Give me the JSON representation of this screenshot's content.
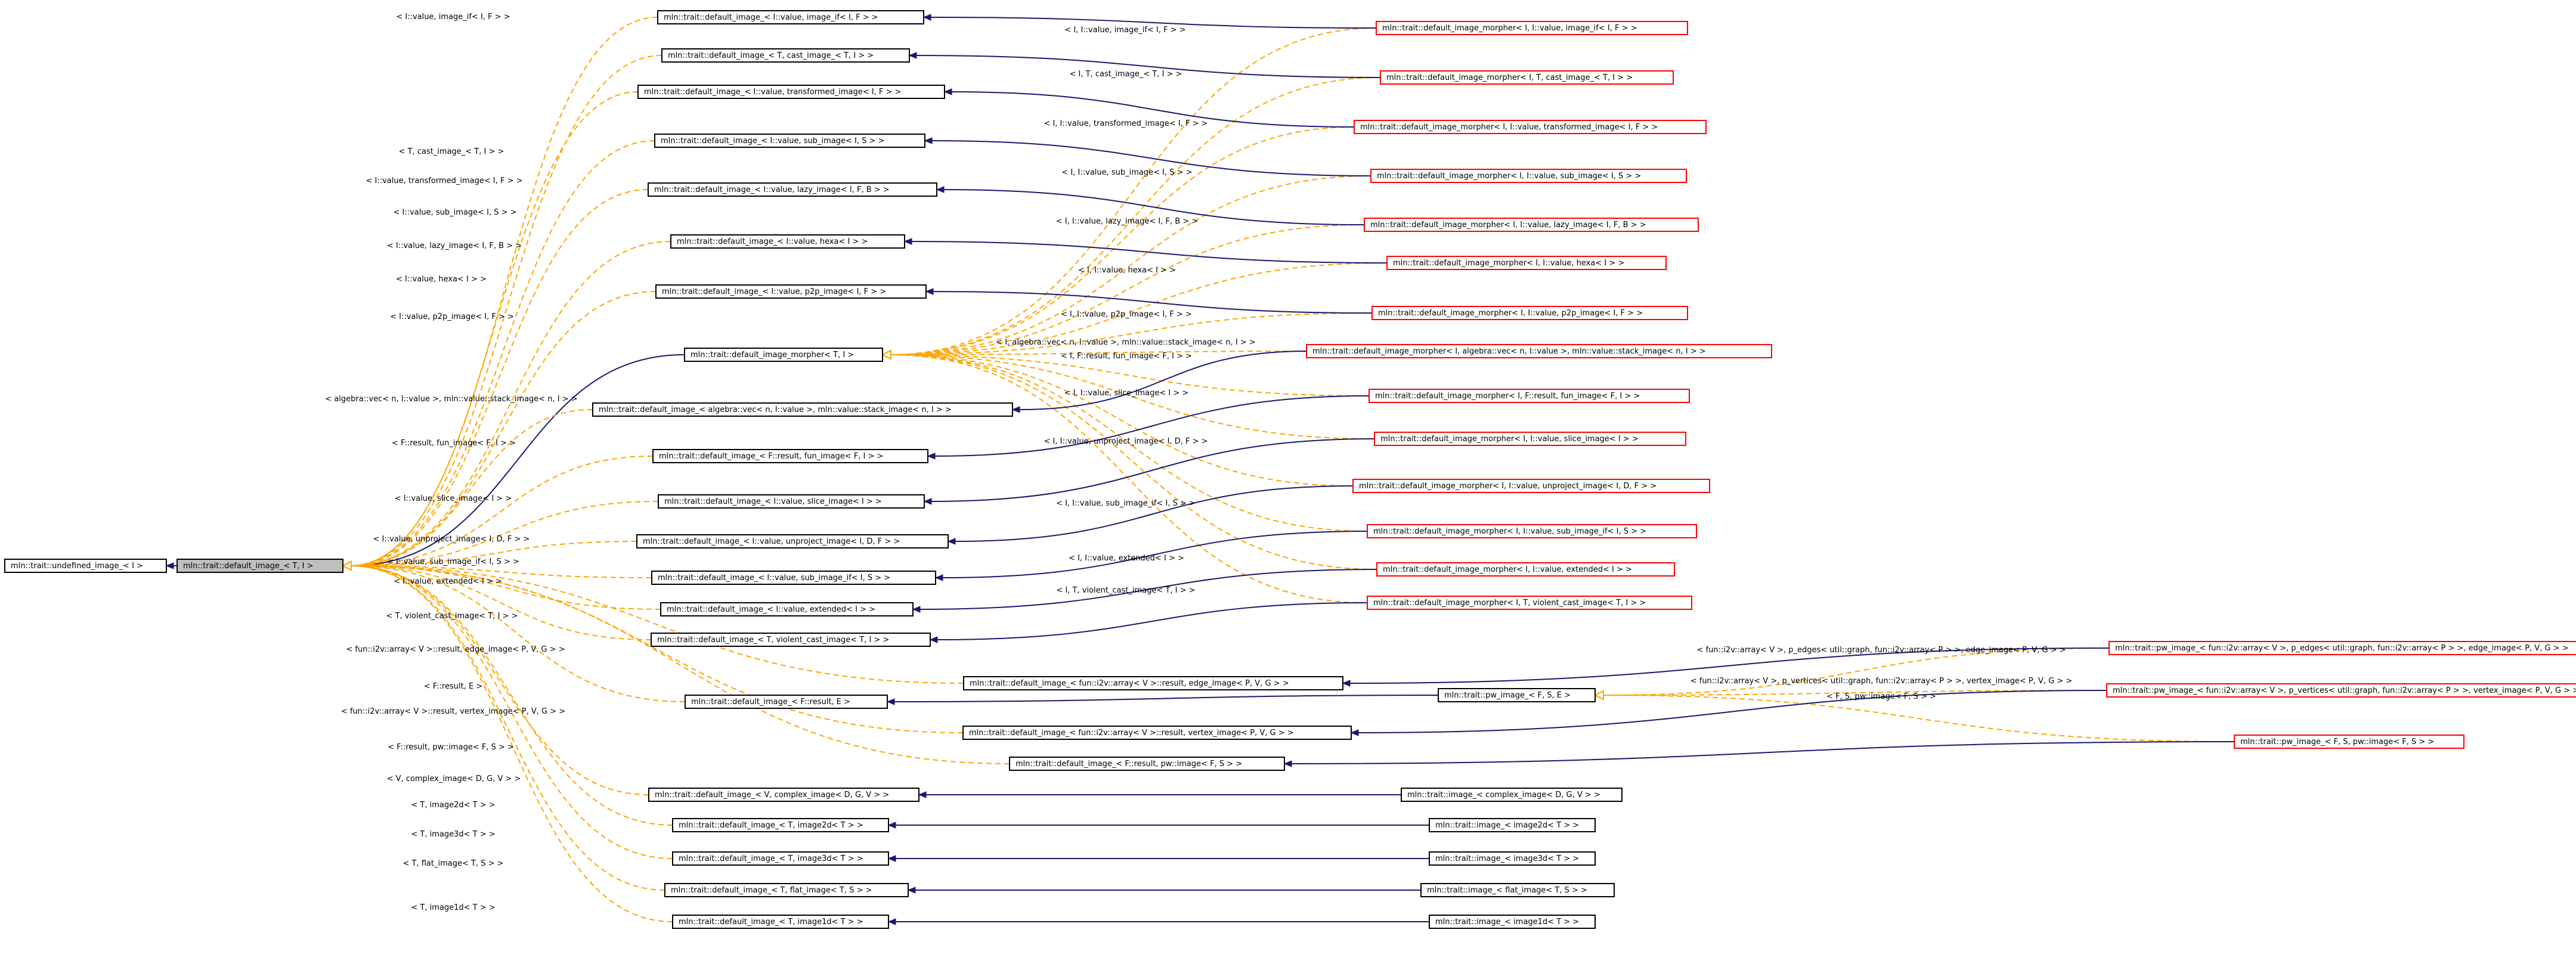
{
  "nodes": [
    {
      "id": "undef",
      "label": "mln::trait::undefined_image_< I >",
      "style": "normal"
    },
    {
      "id": "default",
      "label": "mln::trait::default_image_< T, I >",
      "style": "focus"
    },
    {
      "id": "morpher",
      "label": "mln::trait::default_image_morpher< T, I >",
      "style": "normal"
    },
    {
      "id": "di_image_if",
      "label": "mln::trait::default_image_< I::value, image_if< I, F > >",
      "style": "normal"
    },
    {
      "id": "di_cast",
      "label": "mln::trait::default_image_< T, cast_image_< T, I > >",
      "style": "normal"
    },
    {
      "id": "di_transformed",
      "label": "mln::trait::default_image_< I::value, transformed_image< I, F > >",
      "style": "normal"
    },
    {
      "id": "di_sub",
      "label": "mln::trait::default_image_< I::value, sub_image< I, S > >",
      "style": "normal"
    },
    {
      "id": "di_lazy",
      "label": "mln::trait::default_image_< I::value, lazy_image< I, F, B > >",
      "style": "normal"
    },
    {
      "id": "di_hexa",
      "label": "mln::trait::default_image_< I::value, hexa< I > >",
      "style": "normal"
    },
    {
      "id": "di_p2p",
      "label": "mln::trait::default_image_< I::value, p2p_image< I, F > >",
      "style": "normal"
    },
    {
      "id": "di_stack",
      "label": "mln::trait::default_image_< algebra::vec< n, I::value >, mln::value::stack_image< n, I > >",
      "style": "normal"
    },
    {
      "id": "di_fun",
      "label": "mln::trait::default_image_< F::result, fun_image< F, I > >",
      "style": "normal"
    },
    {
      "id": "di_slice",
      "label": "mln::trait::default_image_< I::value, slice_image< I > >",
      "style": "normal"
    },
    {
      "id": "di_unproject",
      "label": "mln::trait::default_image_< I::value, unproject_image< I, D, F > >",
      "style": "normal"
    },
    {
      "id": "di_subif",
      "label": "mln::trait::default_image_< I::value, sub_image_if< I, S > >",
      "style": "normal"
    },
    {
      "id": "di_extended",
      "label": "mln::trait::default_image_< I::value, extended< I > >",
      "style": "normal"
    },
    {
      "id": "di_violent",
      "label": "mln::trait::default_image_< T, violent_cast_image< T, I > >",
      "style": "normal"
    },
    {
      "id": "di_edge",
      "label": "mln::trait::default_image_< fun::i2v::array< V >::result, edge_image< P, V, G > >",
      "style": "normal"
    },
    {
      "id": "di_fresult_e",
      "label": "mln::trait::default_image_< F::result, E >",
      "style": "normal"
    },
    {
      "id": "di_vertex",
      "label": "mln::trait::default_image_< fun::i2v::array< V >::result, vertex_image< P, V, G > >",
      "style": "normal"
    },
    {
      "id": "di_pw",
      "label": "mln::trait::default_image_< F::result, pw::image< F, S > >",
      "style": "normal"
    },
    {
      "id": "di_complex",
      "label": "mln::trait::default_image_< V, complex_image< D, G, V > >",
      "style": "normal"
    },
    {
      "id": "di_image2d",
      "label": "mln::trait::default_image_< T, image2d< T > >",
      "style": "normal"
    },
    {
      "id": "di_image3d",
      "label": "mln::trait::default_image_< T, image3d< T > >",
      "style": "normal"
    },
    {
      "id": "di_flat",
      "label": "mln::trait::default_image_< T, flat_image< T, S > >",
      "style": "normal"
    },
    {
      "id": "di_image1d",
      "label": "mln::trait::default_image_< T, image1d< T > >",
      "style": "normal"
    },
    {
      "id": "pw_fse",
      "label": "mln::trait::pw_image_< F, S, E >",
      "style": "normal"
    },
    {
      "id": "img_complex",
      "label": "mln::trait::image_< complex_image< D, G, V > >",
      "style": "normal"
    },
    {
      "id": "img_2d",
      "label": "mln::trait::image_< image2d< T > >",
      "style": "normal"
    },
    {
      "id": "img_3d",
      "label": "mln::trait::image_< image3d< T > >",
      "style": "normal"
    },
    {
      "id": "img_flat",
      "label": "mln::trait::image_< flat_image< T, S > >",
      "style": "normal"
    },
    {
      "id": "img_1d",
      "label": "mln::trait::image_< image1d< T > >",
      "style": "normal"
    },
    {
      "id": "dm_image_if",
      "label": "mln::trait::default_image_morpher< I, I::value, image_if< I, F > >",
      "style": "red"
    },
    {
      "id": "dm_cast",
      "label": "mln::trait::default_image_morpher< I, T, cast_image_< T, I > >",
      "style": "red"
    },
    {
      "id": "dm_transformed",
      "label": "mln::trait::default_image_morpher< I, I::value, transformed_image< I, F > >",
      "style": "red"
    },
    {
      "id": "dm_sub",
      "label": "mln::trait::default_image_morpher< I, I::value, sub_image< I, S > >",
      "style": "red"
    },
    {
      "id": "dm_lazy",
      "label": "mln::trait::default_image_morpher< I, I::value, lazy_image< I, F, B > >",
      "style": "red"
    },
    {
      "id": "dm_hexa",
      "label": "mln::trait::default_image_morpher< I, I::value, hexa< I > >",
      "style": "red"
    },
    {
      "id": "dm_p2p",
      "label": "mln::trait::default_image_morpher< I, I::value, p2p_image< I, F > >",
      "style": "red"
    },
    {
      "id": "dm_stack",
      "label": "mln::trait::default_image_morpher< I, algebra::vec< n, I::value >, mln::value::stack_image< n, I > >",
      "style": "red"
    },
    {
      "id": "dm_fun",
      "label": "mln::trait::default_image_morpher< I, F::result, fun_image< F, I > >",
      "style": "red"
    },
    {
      "id": "dm_slice",
      "label": "mln::trait::default_image_morpher< I, I::value, slice_image< I > >",
      "style": "red"
    },
    {
      "id": "dm_unproject",
      "label": "mln::trait::default_image_morpher< I, I::value, unproject_image< I, D, F > >",
      "style": "red"
    },
    {
      "id": "dm_subif",
      "label": "mln::trait::default_image_morpher< I, I::value, sub_image_if< I, S > >",
      "style": "red"
    },
    {
      "id": "dm_extended",
      "label": "mln::trait::default_image_morpher< I, I::value, extended< I > >",
      "style": "red"
    },
    {
      "id": "dm_violent",
      "label": "mln::trait::default_image_morpher< I, T, violent_cast_image< T, I > >",
      "style": "red"
    },
    {
      "id": "pw_edge",
      "label": "mln::trait::pw_image_< fun::i2v::array< V >, p_edges< util::graph, fun::i2v::array< P > >, edge_image< P, V, G > >",
      "style": "red"
    },
    {
      "id": "pw_vertex",
      "label": "mln::trait::pw_image_< fun::i2v::array< V >, p_vertices< util::graph, fun::i2v::array< P > >, vertex_image< P, V, G > >",
      "style": "red"
    },
    {
      "id": "pw_image",
      "label": "mln::trait::pw_image_< F, S, pw::image< F, S > >",
      "style": "red"
    }
  ],
  "edges": [
    {
      "from": "default",
      "to": "undef",
      "style": "solid"
    },
    {
      "from": "morpher",
      "to": "default",
      "style": "solid"
    },
    {
      "from": "di_image_if",
      "to": "default",
      "style": "dashed",
      "label": "< I::value, image_if< I, F > >"
    },
    {
      "from": "di_cast",
      "to": "default",
      "style": "dashed",
      "label": "< T, cast_image_< T, I > >"
    },
    {
      "from": "di_transformed",
      "to": "default",
      "style": "dashed",
      "label": "< I::value, transformed_image< I, F > >"
    },
    {
      "from": "di_sub",
      "to": "default",
      "style": "dashed",
      "label": "< I::value, sub_image< I, S > >"
    },
    {
      "from": "di_lazy",
      "to": "default",
      "style": "dashed",
      "label": "< I::value, lazy_image< I, F, B > >"
    },
    {
      "from": "di_hexa",
      "to": "default",
      "style": "dashed",
      "label": "< I::value, hexa< I > >"
    },
    {
      "from": "di_p2p",
      "to": "default",
      "style": "dashed",
      "label": "< I::value, p2p_image< I, F > >"
    },
    {
      "from": "di_stack",
      "to": "default",
      "style": "dashed",
      "label": "< algebra::vec< n, I::value >, mln::value::stack_image< n, I > >"
    },
    {
      "from": "di_fun",
      "to": "default",
      "style": "dashed",
      "label": "< F::result, fun_image< F, I > >"
    },
    {
      "from": "di_slice",
      "to": "default",
      "style": "dashed",
      "label": "< I::value, slice_image< I > >"
    },
    {
      "from": "di_unproject",
      "to": "default",
      "style": "dashed",
      "label": "< I::value, unproject_image< I, D, F > >"
    },
    {
      "from": "di_subif",
      "to": "default",
      "style": "dashed",
      "label": "< I::value, sub_image_if< I, S > >"
    },
    {
      "from": "di_extended",
      "to": "default",
      "style": "dashed",
      "label": "< I::value, extended< I > >"
    },
    {
      "from": "di_violent",
      "to": "default",
      "style": "dashed",
      "label": "< T, violent_cast_image< T, I > >"
    },
    {
      "from": "di_edge",
      "to": "default",
      "style": "dashed",
      "label": "< fun::i2v::array< V >::result, edge_image< P, V, G > >"
    },
    {
      "from": "di_fresult_e",
      "to": "default",
      "style": "dashed",
      "label": "< F::result, E >"
    },
    {
      "from": "di_vertex",
      "to": "default",
      "style": "dashed",
      "label": "< fun::i2v::array< V >::result, vertex_image< P, V, G > >"
    },
    {
      "from": "di_pw",
      "to": "default",
      "style": "dashed",
      "label": "< F::result, pw::image< F, S > >"
    },
    {
      "from": "di_complex",
      "to": "default",
      "style": "dashed",
      "label": "< V, complex_image< D, G, V > >"
    },
    {
      "from": "di_image2d",
      "to": "default",
      "style": "dashed",
      "label": "< T, image2d< T > >"
    },
    {
      "from": "di_image3d",
      "to": "default",
      "style": "dashed",
      "label": "< T, image3d< T > >"
    },
    {
      "from": "di_flat",
      "to": "default",
      "style": "dashed",
      "label": "< T, flat_image< T, S > >"
    },
    {
      "from": "di_image1d",
      "to": "default",
      "style": "dashed",
      "label": "< T, image1d< T > >"
    },
    {
      "from": "dm_image_if",
      "to": "morpher",
      "style": "dashed",
      "label": "< I, I::value, image_if< I, F > >"
    },
    {
      "from": "dm_cast",
      "to": "morpher",
      "style": "dashed",
      "label": "< I, T, cast_image_< T, I > >"
    },
    {
      "from": "dm_transformed",
      "to": "morpher",
      "style": "dashed",
      "label": "< I, I::value, transformed_image< I, F > >"
    },
    {
      "from": "dm_sub",
      "to": "morpher",
      "style": "dashed",
      "label": "< I, I::value, sub_image< I, S > >"
    },
    {
      "from": "dm_lazy",
      "to": "morpher",
      "style": "dashed",
      "label": "< I, I::value, lazy_image< I, F, B > >"
    },
    {
      "from": "dm_hexa",
      "to": "morpher",
      "style": "dashed",
      "label": "< I, I::value, hexa< I > >"
    },
    {
      "from": "dm_p2p",
      "to": "morpher",
      "style": "dashed",
      "label": "< I, I::value, p2p_image< I, F > >"
    },
    {
      "from": "dm_stack",
      "to": "morpher",
      "style": "dashed",
      "label": "< I, algebra::vec< n, I::value >, mln::value::stack_image< n, I > >"
    },
    {
      "from": "dm_fun",
      "to": "morpher",
      "style": "dashed",
      "label": "< I, F::result, fun_image< F, I > >"
    },
    {
      "from": "dm_slice",
      "to": "morpher",
      "style": "dashed",
      "label": "< I, I::value, slice_image< I > >"
    },
    {
      "from": "dm_unproject",
      "to": "morpher",
      "style": "dashed",
      "label": "< I, I::value, unproject_image< I, D, F > >"
    },
    {
      "from": "dm_subif",
      "to": "morpher",
      "style": "dashed",
      "label": "< I, I::value, sub_image_if< I, S > >"
    },
    {
      "from": "dm_extended",
      "to": "morpher",
      "style": "dashed",
      "label": "< I, I::value, extended< I > >"
    },
    {
      "from": "dm_violent",
      "to": "morpher",
      "style": "dashed",
      "label": "< I, T, violent_cast_image< T, I > >"
    },
    {
      "from": "dm_image_if",
      "to": "di_image_if",
      "style": "solid"
    },
    {
      "from": "dm_cast",
      "to": "di_cast",
      "style": "solid"
    },
    {
      "from": "dm_transformed",
      "to": "di_transformed",
      "style": "solid"
    },
    {
      "from": "dm_sub",
      "to": "di_sub",
      "style": "solid"
    },
    {
      "from": "dm_lazy",
      "to": "di_lazy",
      "style": "solid"
    },
    {
      "from": "dm_hexa",
      "to": "di_hexa",
      "style": "solid"
    },
    {
      "from": "dm_p2p",
      "to": "di_p2p",
      "style": "solid"
    },
    {
      "from": "dm_stack",
      "to": "di_stack",
      "style": "solid"
    },
    {
      "from": "dm_fun",
      "to": "di_fun",
      "style": "solid"
    },
    {
      "from": "dm_slice",
      "to": "di_slice",
      "style": "solid"
    },
    {
      "from": "dm_unproject",
      "to": "di_unproject",
      "style": "solid"
    },
    {
      "from": "dm_subif",
      "to": "di_subif",
      "style": "solid"
    },
    {
      "from": "dm_extended",
      "to": "di_extended",
      "style": "solid"
    },
    {
      "from": "dm_violent",
      "to": "di_violent",
      "style": "solid"
    },
    {
      "from": "pw_fse",
      "to": "di_fresult_e",
      "style": "solid"
    },
    {
      "from": "pw_edge",
      "to": "pw_fse",
      "style": "dashed",
      "label": "< fun::i2v::array< V >, p_edges< util::graph, fun::i2v::array< P > >, edge_image< P, V, G > >"
    },
    {
      "from": "pw_vertex",
      "to": "pw_fse",
      "style": "dashed",
      "label": "< fun::i2v::array< V >, p_vertices< util::graph, fun::i2v::array< P > >, vertex_image< P, V, G > >"
    },
    {
      "from": "pw_image",
      "to": "pw_fse",
      "style": "dashed",
      "label": "< F, S, pw::image< F, S > >"
    },
    {
      "from": "pw_edge",
      "to": "di_edge",
      "style": "solid"
    },
    {
      "from": "pw_vertex",
      "to": "di_vertex",
      "style": "solid"
    },
    {
      "from": "pw_image",
      "to": "di_pw",
      "style": "solid"
    },
    {
      "from": "img_complex",
      "to": "di_complex",
      "style": "solid"
    },
    {
      "from": "img_2d",
      "to": "di_image2d",
      "style": "solid"
    },
    {
      "from": "img_3d",
      "to": "di_image3d",
      "style": "solid"
    },
    {
      "from": "img_flat",
      "to": "di_flat",
      "style": "solid"
    },
    {
      "from": "img_1d",
      "to": "di_image1d",
      "style": "solid"
    }
  ],
  "colors": {
    "solid_edge": "#191970",
    "dashed_edge": "#ffa500",
    "focus_fill": "#bfbfbf",
    "red_border": "#ff0000",
    "node_border": "#000000"
  }
}
